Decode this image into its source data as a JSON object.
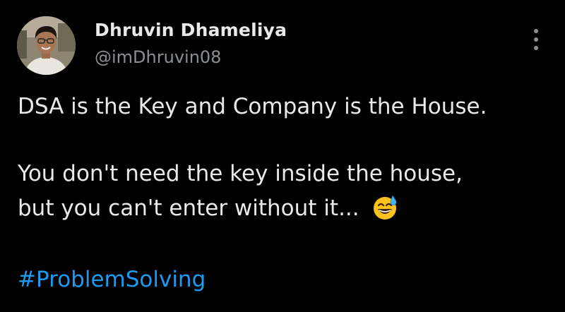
{
  "author": {
    "name": "Dhruvin Dhameliya",
    "handle": "@imDhruvin08"
  },
  "tweet": {
    "line1": "DSA is the Key and Company is the House.",
    "line2": "You don't need the key inside the house,",
    "line3": "but you can't enter without it...",
    "emoji": "grinning-face-with-sweat",
    "hashtag": "#ProblemSolving"
  },
  "colors": {
    "background": "#000000",
    "primary_text": "#e7e9ea",
    "secondary_text": "#8b8f94",
    "link": "#1d9bf0"
  }
}
